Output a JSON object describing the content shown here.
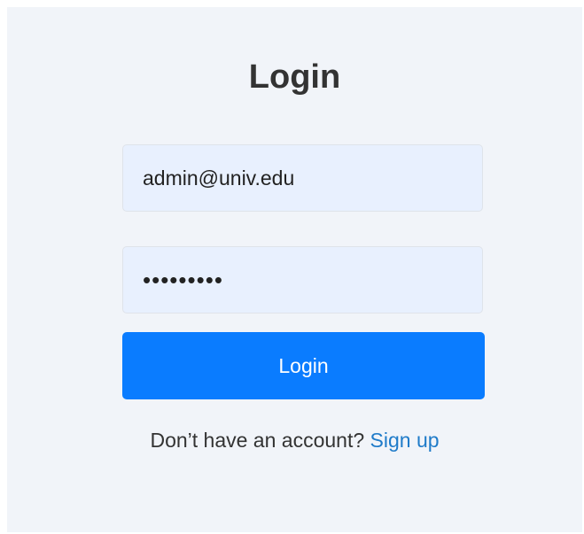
{
  "login": {
    "title": "Login",
    "email_value": "admin@univ.edu",
    "password_value": "•••••••••",
    "button_label": "Login",
    "signup_prompt": "Don’t have an account?",
    "signup_link": "Sign up"
  },
  "colors": {
    "background": "#f1f4f9",
    "input_fill": "#e8f0fe",
    "button": "#0a7cff",
    "link": "#1f7bc9"
  }
}
